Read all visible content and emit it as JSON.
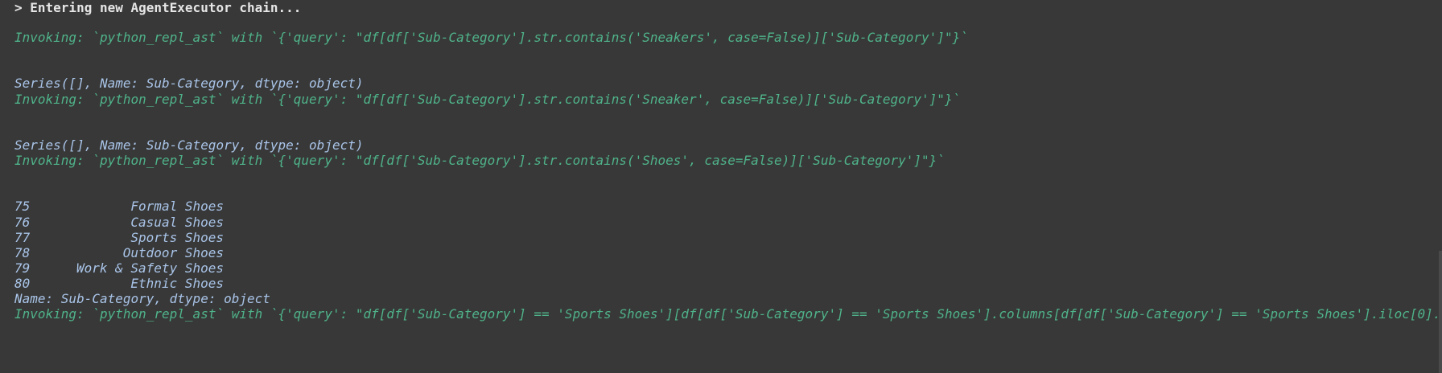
{
  "terminal": {
    "header": "> Entering new AgentExecutor chain...",
    "invoke_1": "Invoking: `python_repl_ast` with `{'query': \"df[df['Sub-Category'].str.contains('Sneakers', case=False)]['Sub-Category']\"}`",
    "output_1": "Series([], Name: Sub-Category, dtype: object)",
    "invoke_2": "Invoking: `python_repl_ast` with `{'query': \"df[df['Sub-Category'].str.contains('Sneaker', case=False)]['Sub-Category']\"}`",
    "output_2": "Series([], Name: Sub-Category, dtype: object)",
    "invoke_3": "Invoking: `python_repl_ast` with `{'query': \"df[df['Sub-Category'].str.contains('Shoes', case=False)]['Sub-Category']\"}`",
    "rows": [
      {
        "index": "75",
        "value": "Formal Shoes"
      },
      {
        "index": "76",
        "value": "Casual Shoes"
      },
      {
        "index": "77",
        "value": "Sports Shoes"
      },
      {
        "index": "78",
        "value": "Outdoor Shoes"
      },
      {
        "index": "79",
        "value": "Work & Safety Shoes"
      },
      {
        "index": "80",
        "value": "Ethnic Shoes"
      }
    ],
    "series_footer": "Name: Sub-Category, dtype: object",
    "invoke_4": "Invoking: `python_repl_ast` with `{'query': \"df[df['Sub-Category'] == 'Sports Shoes'][df[df['Sub-Category'] == 'Sports Shoes'].columns[df[df['Sub-Category'] == 'Sports Shoes'].iloc[0]."
  }
}
